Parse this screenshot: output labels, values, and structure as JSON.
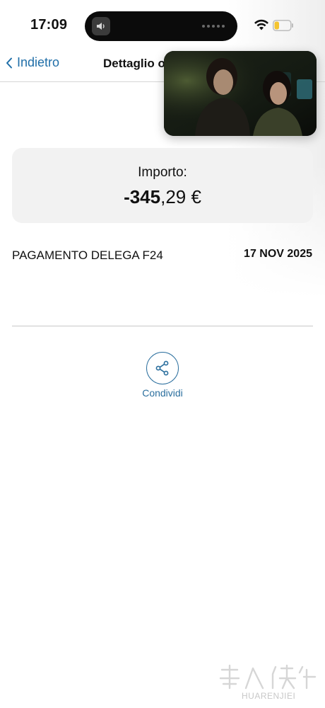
{
  "status_bar": {
    "time": "17:09",
    "icons": [
      "speaker-icon",
      "wifi-icon",
      "battery-icon"
    ],
    "battery_level": 0.3,
    "battery_color": "#f4c430"
  },
  "nav": {
    "back_label": "Indietro",
    "title": "Dettaglio o"
  },
  "pip": {
    "description_icon": "video-pip"
  },
  "amount": {
    "label": "Importo:",
    "integer_part": "-345",
    "decimal_part": ",29 €"
  },
  "transaction": {
    "description": "PAGAMENTO DELEGA F24",
    "date": "17 NOV 2025"
  },
  "share": {
    "label": "Condividi",
    "icon": "share-icon"
  },
  "watermark": {
    "text": "HUARENJIEI"
  },
  "colors": {
    "accent": "#1f6ea8",
    "card_bg": "#f2f2f2"
  }
}
